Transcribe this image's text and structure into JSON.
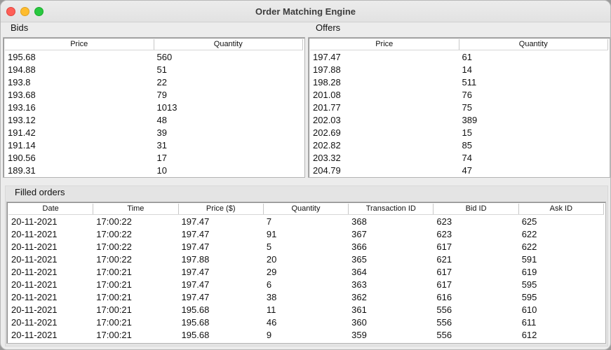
{
  "window": {
    "title": "Order Matching Engine"
  },
  "bids": {
    "label": "Bids",
    "columns": [
      "Price",
      "Quantity"
    ],
    "rows": [
      [
        "195.68",
        "560"
      ],
      [
        "194.88",
        "51"
      ],
      [
        "193.8",
        "22"
      ],
      [
        "193.68",
        "79"
      ],
      [
        "193.16",
        "1013"
      ],
      [
        "193.12",
        "48"
      ],
      [
        "191.42",
        "39"
      ],
      [
        "191.14",
        "31"
      ],
      [
        "190.56",
        "17"
      ],
      [
        "189.31",
        "10"
      ]
    ]
  },
  "offers": {
    "label": "Offers",
    "columns": [
      "Price",
      "Quantity"
    ],
    "rows": [
      [
        "197.47",
        "61"
      ],
      [
        "197.88",
        "14"
      ],
      [
        "198.28",
        "511"
      ],
      [
        "201.08",
        "76"
      ],
      [
        "201.77",
        "75"
      ],
      [
        "202.03",
        "389"
      ],
      [
        "202.69",
        "15"
      ],
      [
        "202.82",
        "85"
      ],
      [
        "203.32",
        "74"
      ],
      [
        "204.79",
        "47"
      ]
    ]
  },
  "filled": {
    "label": "Filled orders",
    "columns": [
      "Date",
      "Time",
      "Price ($)",
      "Quantity",
      "Transaction ID",
      "Bid ID",
      "Ask ID"
    ],
    "rows": [
      [
        "20-11-2021",
        "17:00:22",
        "197.47",
        "7",
        "368",
        "623",
        "625"
      ],
      [
        "20-11-2021",
        "17:00:22",
        "197.47",
        "91",
        "367",
        "623",
        "622"
      ],
      [
        "20-11-2021",
        "17:00:22",
        "197.47",
        "5",
        "366",
        "617",
        "622"
      ],
      [
        "20-11-2021",
        "17:00:22",
        "197.88",
        "20",
        "365",
        "621",
        "591"
      ],
      [
        "20-11-2021",
        "17:00:21",
        "197.47",
        "29",
        "364",
        "617",
        "619"
      ],
      [
        "20-11-2021",
        "17:00:21",
        "197.47",
        "6",
        "363",
        "617",
        "595"
      ],
      [
        "20-11-2021",
        "17:00:21",
        "197.47",
        "38",
        "362",
        "616",
        "595"
      ],
      [
        "20-11-2021",
        "17:00:21",
        "195.68",
        "11",
        "361",
        "556",
        "610"
      ],
      [
        "20-11-2021",
        "17:00:21",
        "195.68",
        "46",
        "360",
        "556",
        "611"
      ],
      [
        "20-11-2021",
        "17:00:21",
        "195.68",
        "9",
        "359",
        "556",
        "612"
      ]
    ]
  }
}
